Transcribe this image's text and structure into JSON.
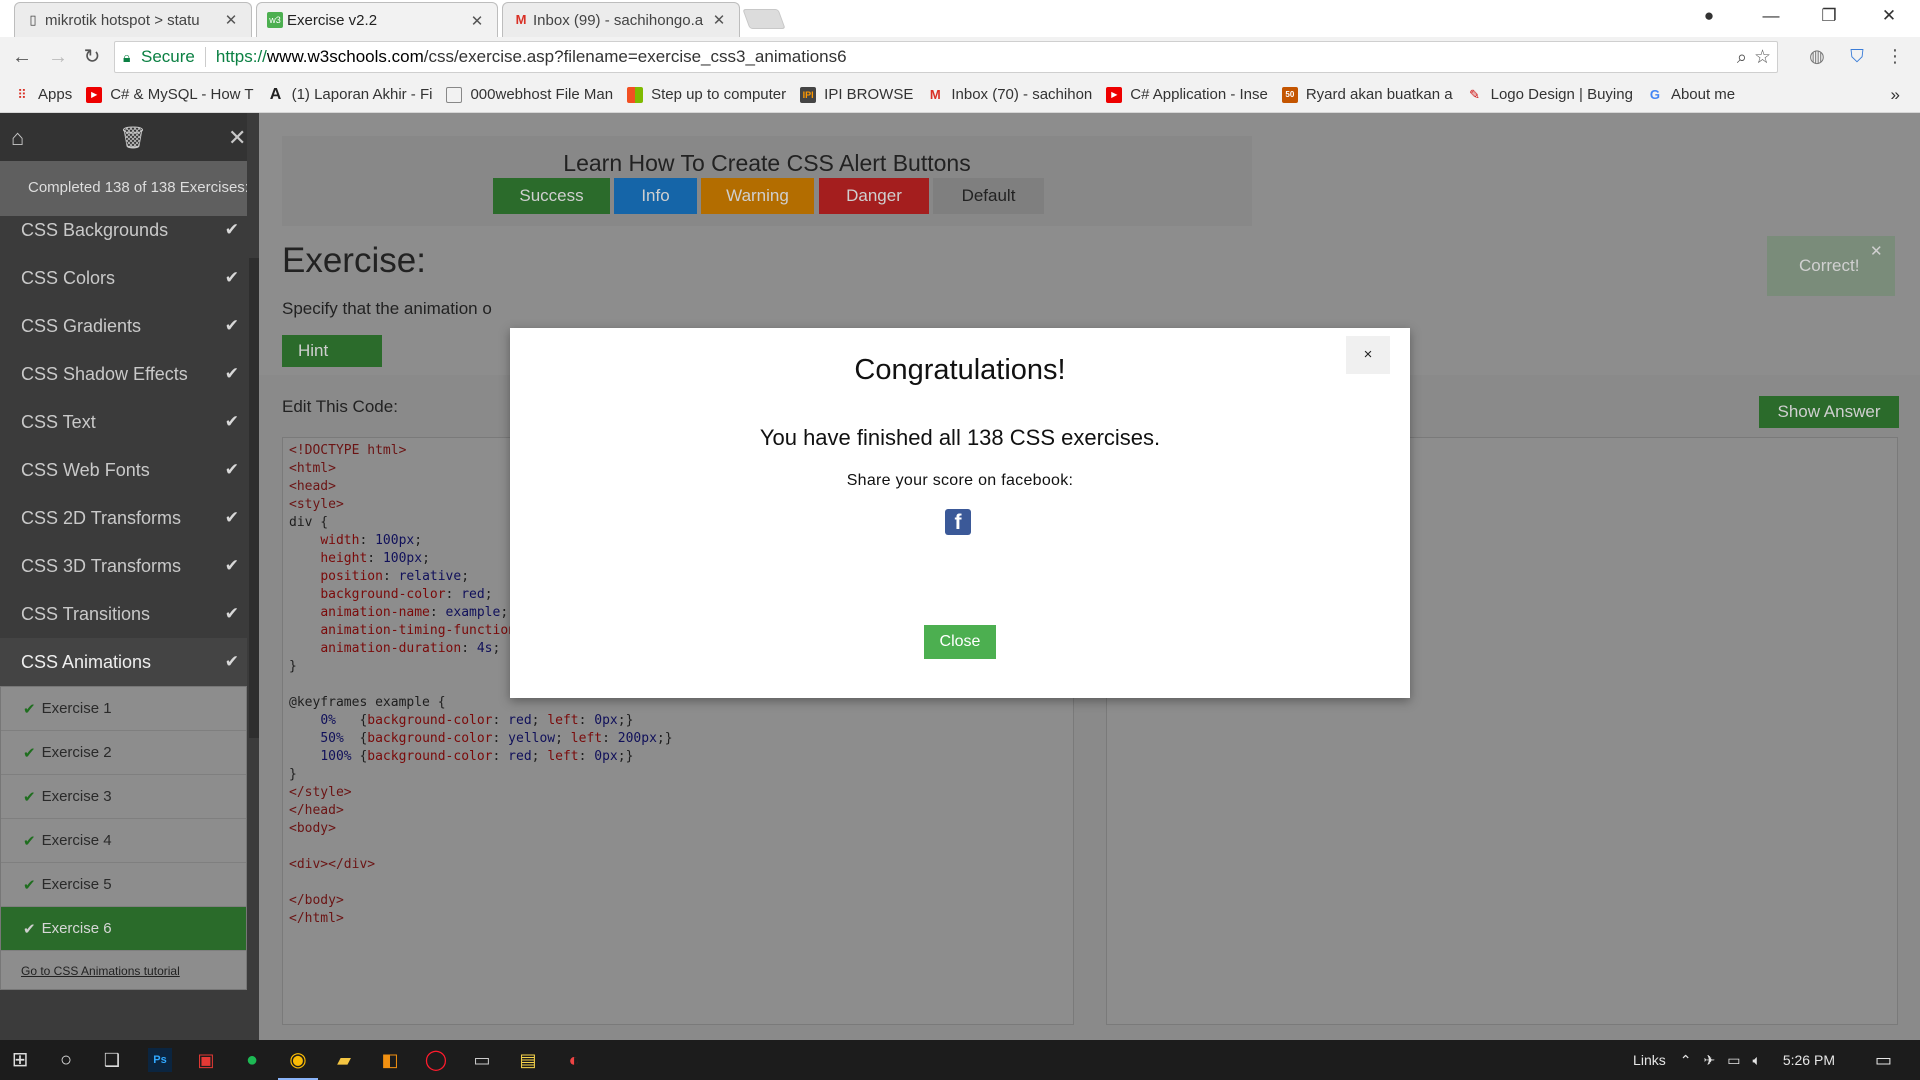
{
  "browser": {
    "tabs": [
      {
        "title": "mikrotik hotspot > statu",
        "icon": "page-icon"
      },
      {
        "title": "Exercise v2.2",
        "icon": "w3-icon"
      },
      {
        "title": "Inbox (99) - sachihongo.a",
        "icon": "gmail-icon"
      }
    ],
    "secure_label": "Secure",
    "url_scheme": "https://",
    "url_host": "www.w3schools.com",
    "url_path": "/css/exercise.asp?filename=exercise_css3_animations6"
  },
  "bookmarks": [
    {
      "label": "Apps",
      "icon": "apps-grid-icon",
      "color": "#d93025"
    },
    {
      "label": "C# & MySQL - How T",
      "icon": "youtube-icon",
      "color": "#e00"
    },
    {
      "label": "(1) Laporan Akhir - Fi",
      "icon": "letter-a-icon",
      "color": "#222"
    },
    {
      "label": "000webhost File Man",
      "icon": "page-icon",
      "color": "#777"
    },
    {
      "label": "Step up to computer",
      "icon": "windows-logo-icon",
      "color": "#f25022"
    },
    {
      "label": "IPI BROWSE",
      "icon": "ipi-icon",
      "color": "#444"
    },
    {
      "label": "Inbox (70) - sachihon",
      "icon": "gmail-icon",
      "color": "#d93025"
    },
    {
      "label": "C# Application - Inse",
      "icon": "youtube-icon",
      "color": "#e00"
    },
    {
      "label": "Ryard akan buatkan a",
      "icon": "fiverr-50-icon",
      "color": "#c45500"
    },
    {
      "label": "Logo Design | Buying",
      "icon": "quill-icon",
      "color": "#c00"
    },
    {
      "label": "About me",
      "icon": "google-icon",
      "color": "#4285f4"
    }
  ],
  "sidebar": {
    "progress": "Completed 138 of 138 Exercises:",
    "topics": [
      "CSS Backgrounds",
      "CSS Colors",
      "CSS Gradients",
      "CSS Shadow Effects",
      "CSS Text",
      "CSS Web Fonts",
      "CSS 2D Transforms",
      "CSS 3D Transforms",
      "CSS Transitions",
      "CSS Animations"
    ],
    "exercises": [
      "Exercise 1",
      "Exercise 2",
      "Exercise 3",
      "Exercise 4",
      "Exercise 5",
      "Exercise 6"
    ],
    "tutorial_link": "Go to CSS Animations tutorial"
  },
  "preview": {
    "title": "Learn How To Create CSS Alert Buttons",
    "buttons": [
      {
        "label": "Success",
        "color": "#2b6b2b"
      },
      {
        "label": "Info",
        "color": "#1565a8"
      },
      {
        "label": "Warning",
        "color": "#b36d00"
      },
      {
        "label": "Danger",
        "color": "#a41e1e"
      },
      {
        "label": "Default",
        "color": "#7f7f7f"
      }
    ]
  },
  "exercise": {
    "heading": "Exercise:",
    "instruction": "Specify that the animation o",
    "hint_label": "Hint",
    "correct_label": "Correct!",
    "edit_label": "Edit This Code:",
    "show_answer_label": "Show Answer"
  },
  "code_lines": [
    "<!DOCTYPE html>",
    "<html>",
    "<head>",
    "<style>",
    "div {",
    "    width: 100px;",
    "    height: 100px;",
    "    position: relative;",
    "    background-color: red;",
    "    animation-name: example;",
    "    animation-timing-function: ease-in-out;",
    "    animation-duration: 4s;",
    "}",
    "",
    "@keyframes example {",
    "    0%   {background-color: red; left:0px;}",
    "    50%  {background-color: yellow; left:200px;}",
    "    100% {background-color: red; left:0px;}",
    "}",
    "</style>",
    "</head>",
    "<body>",
    "",
    "<div></div>",
    "",
    "</body>",
    "</html>"
  ],
  "modal": {
    "title": "Congratulations!",
    "message": "You have finished all 138 CSS exercises.",
    "share": "Share your score on facebook:",
    "close_label": "Close",
    "close_x": "×"
  },
  "taskbar": {
    "links_label": "Links",
    "time": "5:26 PM"
  }
}
